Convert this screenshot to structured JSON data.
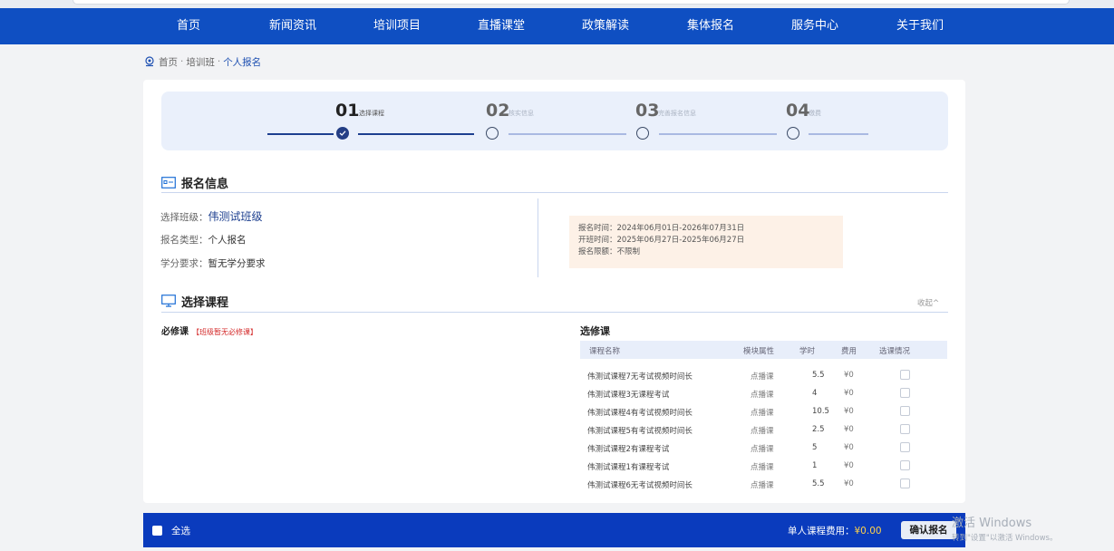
{
  "nav": {
    "items": [
      "首页",
      "新闻资讯",
      "培训项目",
      "直播课堂",
      "政策解读",
      "集体报名",
      "服务中心",
      "关于我们"
    ]
  },
  "breadcrumb": {
    "home": "首页",
    "sep": "·",
    "mid": "培训班",
    "current": "个人报名"
  },
  "steps": [
    {
      "num": "01",
      "label": "选择课程",
      "state": "done"
    },
    {
      "num": "02",
      "label": "核实信息",
      "state": "pending"
    },
    {
      "num": "03",
      "label": "完善报名信息",
      "state": "pending"
    },
    {
      "num": "04",
      "label": "缴费",
      "state": "pending"
    }
  ],
  "signup": {
    "title": "报名信息",
    "class_label": "选择班级：",
    "class_value": "伟测试班级",
    "type_label": "报名类型：",
    "type_value": "个人报名",
    "credit_label": "学分要求：",
    "credit_value": "暂无学分要求",
    "signup_time": "报名时间：2024年06月01日-2026年07月31日",
    "class_time": "开班时间：2025年06月27日-2025年06月27日",
    "quota": "报名限额：不限制"
  },
  "courses": {
    "title": "选择课程",
    "collapse": "收起^",
    "required_title": "必修课",
    "required_note": "【班级暂无必修课】",
    "optional_title": "选修课",
    "headers": [
      "课程名称",
      "模块属性",
      "学时",
      "费用",
      "选课情况"
    ],
    "rows": [
      {
        "name": "伟测试课程7无考试视频时间长",
        "module": "点播课",
        "hours": "5.5",
        "fee": "¥0"
      },
      {
        "name": "伟测试课程3无课程考试",
        "module": "点播课",
        "hours": "4",
        "fee": "¥0"
      },
      {
        "name": "伟测试课程4有考试视频时间长",
        "module": "点播课",
        "hours": "10.5",
        "fee": "¥0"
      },
      {
        "name": "伟测试课程5有考试视频时间长",
        "module": "点播课",
        "hours": "2.5",
        "fee": "¥0"
      },
      {
        "name": "伟测试课程2有课程考试",
        "module": "点播课",
        "hours": "5",
        "fee": "¥0"
      },
      {
        "name": "伟测试课程1有课程考试",
        "module": "点播课",
        "hours": "1",
        "fee": "¥0"
      },
      {
        "name": "伟测试课程6无考试视频时间长",
        "module": "点播课",
        "hours": "5.5",
        "fee": "¥0"
      }
    ]
  },
  "footer": {
    "select_all": "全选",
    "fee_label": "单人课程费用：",
    "fee_value": "¥0.00",
    "confirm": "确认报名"
  },
  "watermark": {
    "line1": "激活 Windows",
    "line2": "转到\"设置\"以激活 Windows。"
  },
  "colors": {
    "nav_bg": "#0f4fc2",
    "footer_bg": "#0a3bbd",
    "accent": "#1d3f8f",
    "fee_amount": "#ffd24a",
    "required_note": "#d42b2b"
  }
}
